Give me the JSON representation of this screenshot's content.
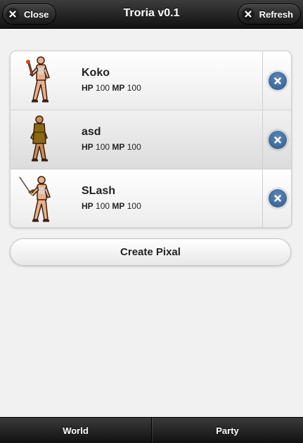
{
  "header": {
    "title": "Troria v0.1",
    "close_label": "Close",
    "refresh_label": "Refresh"
  },
  "characters": [
    {
      "name": "Koko",
      "hp_label": "HP",
      "hp": "100",
      "mp_label": "MP",
      "mp": "100",
      "sprite": "warrior-torch"
    },
    {
      "name": "asd",
      "hp_label": "HP",
      "hp": "100",
      "mp_label": "MP",
      "mp": "100",
      "sprite": "warrior-tunic"
    },
    {
      "name": "SLash",
      "hp_label": "HP",
      "hp": "100",
      "mp_label": "MP",
      "mp": "100",
      "sprite": "warrior-sword"
    }
  ],
  "create_button": {
    "label": "Create Pixal"
  },
  "tabs": [
    {
      "label": "World"
    },
    {
      "label": "Party"
    }
  ],
  "colors": {
    "header": "#1a1a1a",
    "delete_icon": "#3a6ea5",
    "background": "#f1f1f1"
  }
}
